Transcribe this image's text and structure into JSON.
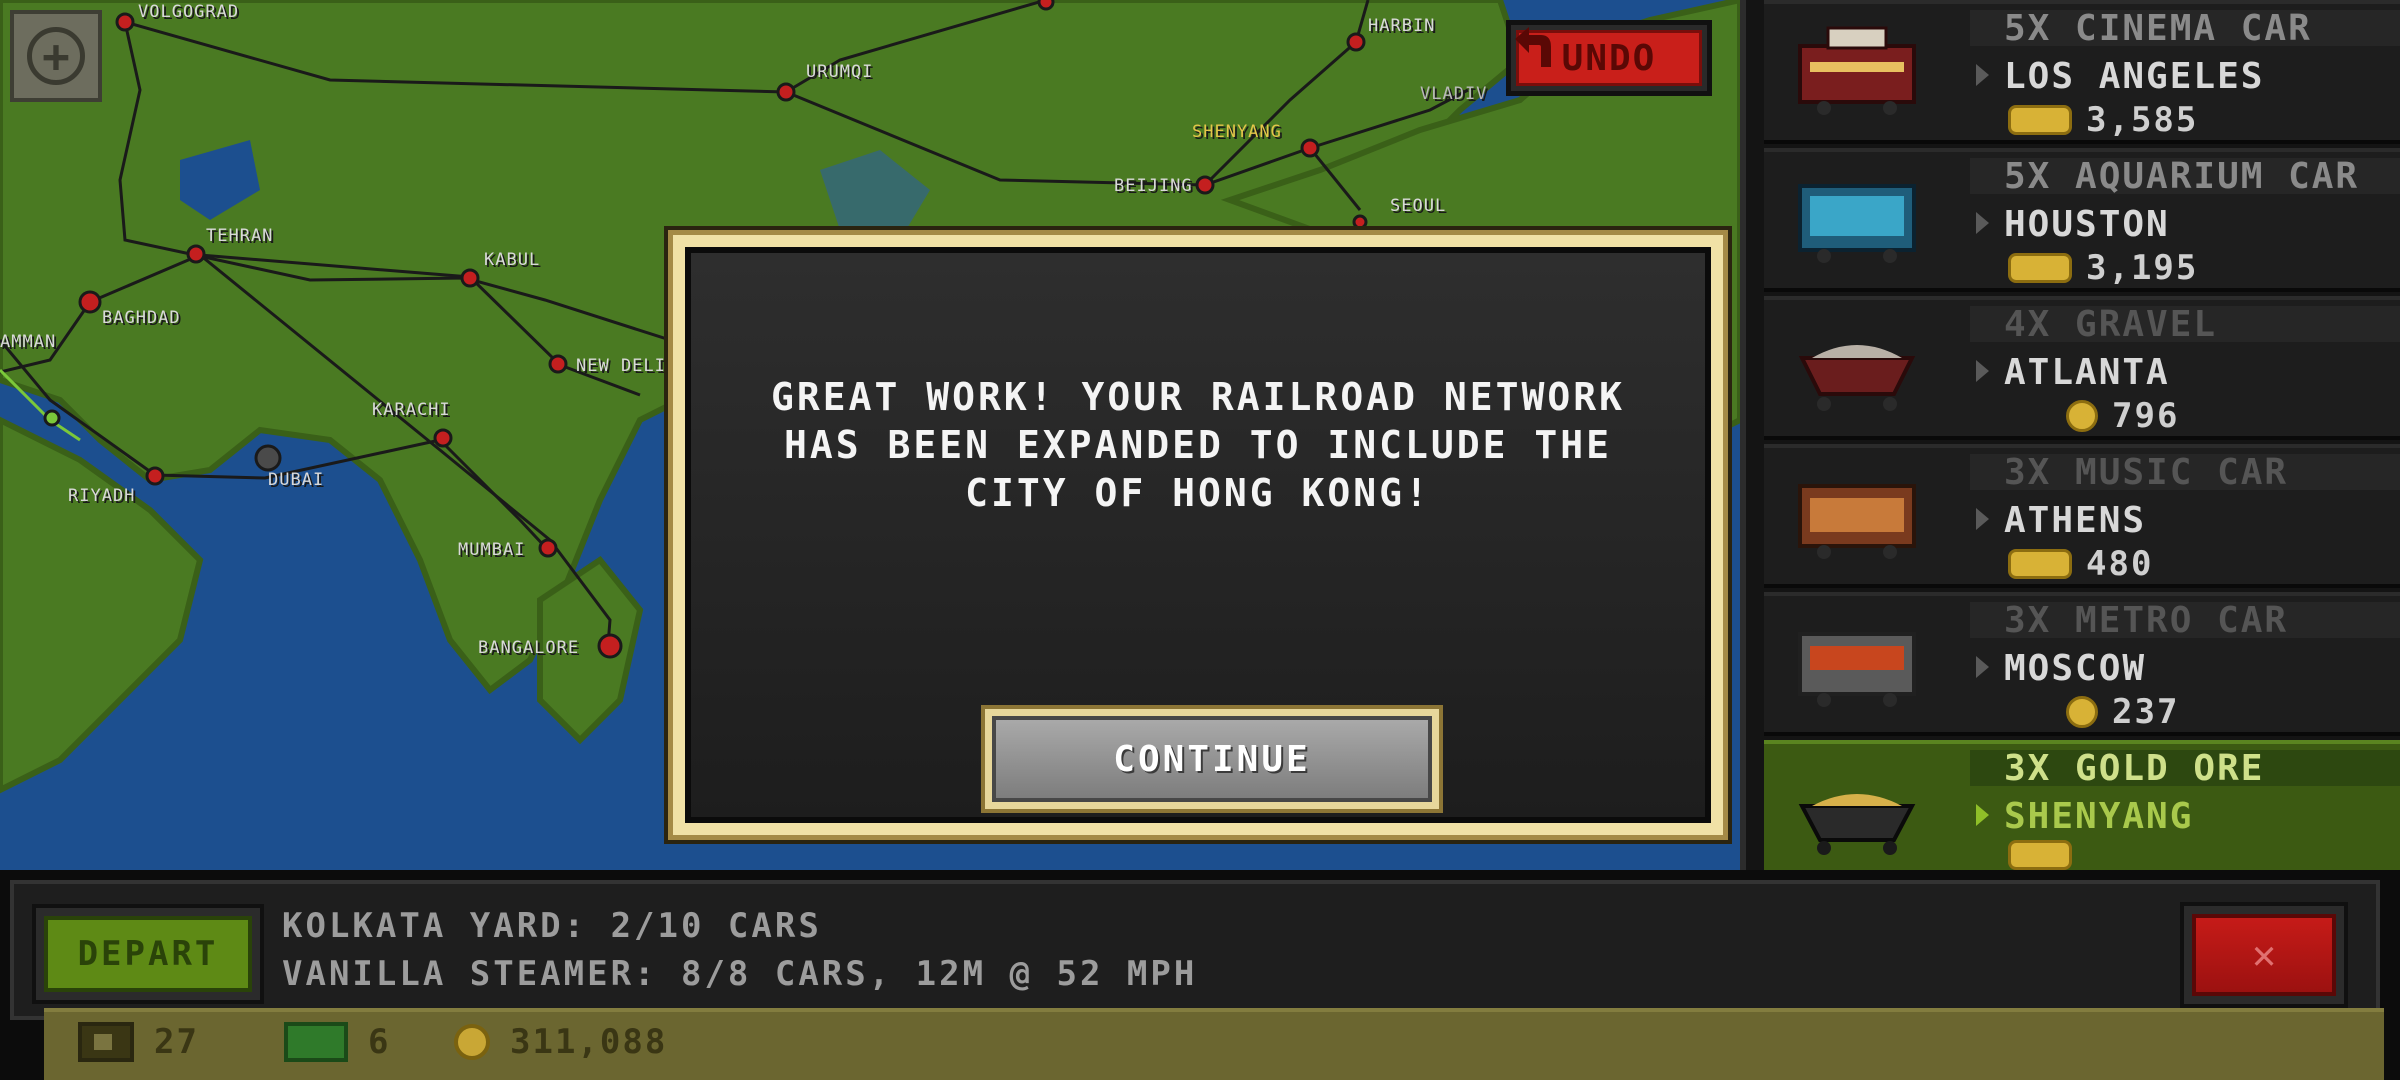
{
  "map": {
    "zoom_icon": "plus-icon",
    "cities": [
      "VOLGOGRAD",
      "HARBIN",
      "URUMQI",
      "VLADIV",
      "SHENYANG",
      "BEIJING",
      "SEOUL",
      "TEHRAN",
      "KABUL",
      "BAGHDAD",
      "AMMAN",
      "NEW DELI",
      "KARACHI",
      "RIYADH",
      "DUBAI",
      "MUMBAI",
      "BANGALORE"
    ]
  },
  "undo": {
    "label": "UNDO",
    "icon": "undo-arrow-icon"
  },
  "cars": [
    {
      "name": "5X CINEMA CAR",
      "dest": "LOS ANGELES",
      "reward": "3,585",
      "reward_icon": "gold-bars-icon"
    },
    {
      "name": "5X AQUARIUM CAR",
      "dest": "HOUSTON",
      "reward": "3,195",
      "reward_icon": "gold-bars-icon"
    },
    {
      "name": "4X GRAVEL",
      "dest": "ATLANTA",
      "reward": "796",
      "reward_icon": "coin-icon"
    },
    {
      "name": "3X MUSIC CAR",
      "dest": "ATHENS",
      "reward": "480",
      "reward_icon": "gold-bars-icon"
    },
    {
      "name": "3X METRO CAR",
      "dest": "MOSCOW",
      "reward": "237",
      "reward_icon": "coin-icon"
    },
    {
      "name": "3X GOLD ORE",
      "dest": "SHENYANG",
      "reward": "",
      "reward_icon": "gold-bars-icon"
    }
  ],
  "dialog": {
    "line1": "GREAT WORK! YOUR RAILROAD NETWORK",
    "line2": "HAS BEEN EXPANDED TO INCLUDE THE",
    "line3": "CITY OF HONG KONG!",
    "continue_label": "CONTINUE"
  },
  "bottom": {
    "depart_label": "DEPART",
    "yard_line": "KOLKATA YARD: 2/10 CARS",
    "train_line": "VANILLA STEAMER: 8/8 CARS, 12M @ 52 MPH",
    "close_label": "✕"
  },
  "resources": {
    "cars": "27",
    "cash": "6",
    "coins": "311,088"
  },
  "colors": {
    "ocean": "#1c4f8f",
    "land": "#4a7a22",
    "accent_gold": "#f0e1a6",
    "depart_green": "#5e8a15",
    "close_red": "#c61b18"
  }
}
